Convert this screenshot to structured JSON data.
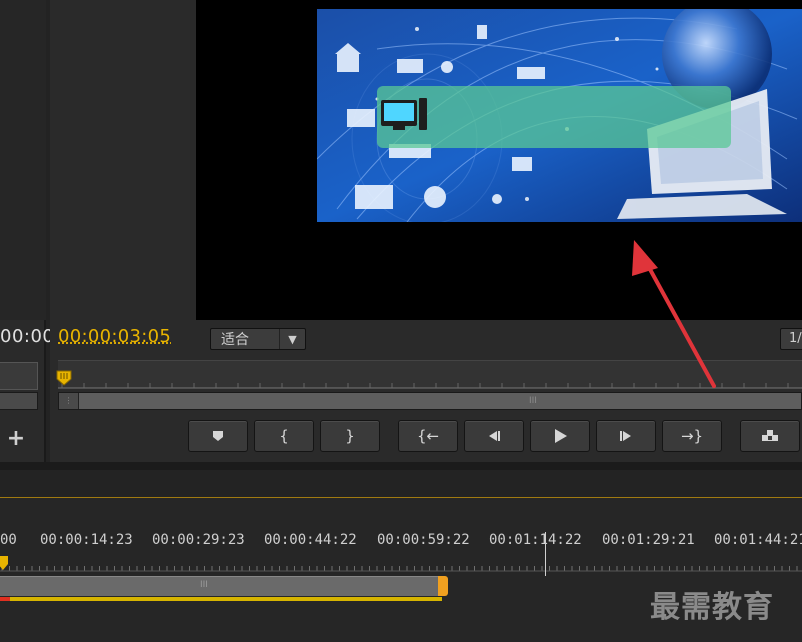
{
  "source_monitor": {
    "timecode": "00:00"
  },
  "program_monitor": {
    "timecode": "00:00:03:05",
    "fit_select": {
      "value": "适合"
    },
    "resolution_select": {
      "value": "1/"
    },
    "scroll_grip": "III",
    "transport_buttons": [
      {
        "icon": "marker-icon",
        "name": "add-marker-button"
      },
      {
        "icon": "mark-in-icon",
        "name": "mark-in-button"
      },
      {
        "icon": "mark-out-icon",
        "name": "mark-out-button"
      },
      {
        "icon": "go-to-in-icon",
        "name": "go-to-in-button"
      },
      {
        "icon": "step-back-icon",
        "name": "step-back-button"
      },
      {
        "icon": "play-icon",
        "name": "play-button"
      },
      {
        "icon": "step-forward-icon",
        "name": "step-forward-button"
      },
      {
        "icon": "go-to-out-icon",
        "name": "go-to-out-button"
      },
      {
        "icon": "lift-icon",
        "name": "lift-button"
      }
    ]
  },
  "timeline": {
    "ruler_labels": [
      "00",
      "00:00:14:23",
      "00:00:29:23",
      "00:00:44:22",
      "00:00:59:22",
      "00:01:14:22",
      "00:01:29:21",
      "00:01:44:21"
    ],
    "clip_grip": "III"
  },
  "watermark": "最需教育",
  "colors": {
    "timecode": "#e8b400",
    "clip_end": "#f0a020",
    "arrow": "#e0343a"
  }
}
